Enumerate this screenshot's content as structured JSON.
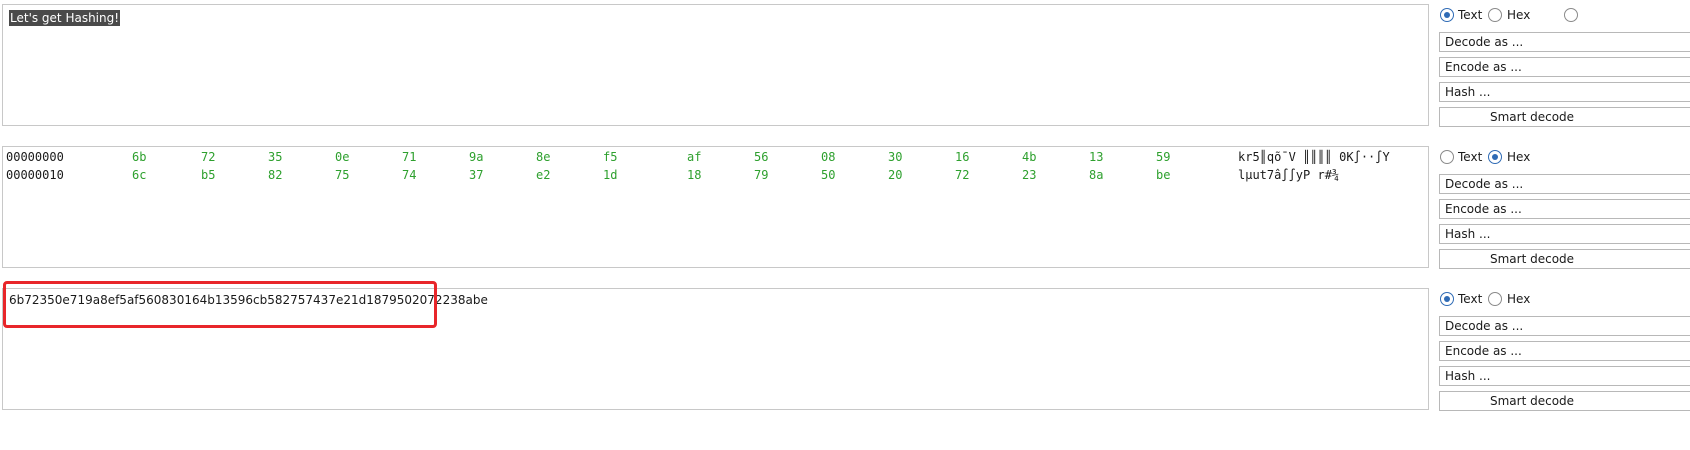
{
  "panels": [
    {
      "content_text": "Let's get Hashing!",
      "mode_options": [
        "Text",
        "Hex"
      ],
      "selected_mode": "Text",
      "decode_label": "Decode as ...",
      "encode_label": "Encode as ...",
      "hash_label": "Hash ...",
      "smart_decode_label": "Smart decode"
    },
    {
      "hex_rows": [
        {
          "offset": "00000000",
          "bytes": [
            "6b",
            "72",
            "35",
            "0e",
            "71",
            "9a",
            "8e",
            "f5",
            "af",
            "56",
            "08",
            "30",
            "16",
            "4b",
            "13",
            "59"
          ],
          "ascii": "kr5║qõˉV ║║║║ 0K∫··∫Y"
        },
        {
          "offset": "00000010",
          "bytes": [
            "6c",
            "b5",
            "82",
            "75",
            "74",
            "37",
            "e2",
            "1d",
            "18",
            "79",
            "50",
            "20",
            "72",
            "23",
            "8a",
            "be"
          ],
          "ascii": "lµut7â∫∫yP r#¾"
        }
      ],
      "mode_options": [
        "Text",
        "Hex"
      ],
      "selected_mode": "Hex",
      "decode_label": "Decode as ...",
      "encode_label": "Encode as ...",
      "hash_label": "Hash ...",
      "smart_decode_label": "Smart decode"
    },
    {
      "content_text": "6b72350e719a8ef5af560830164b13596cb582757437e21d1879502072238abe",
      "mode_options": [
        "Text",
        "Hex"
      ],
      "selected_mode": "Text",
      "decode_label": "Decode as ...",
      "encode_label": "Encode as ...",
      "hash_label": "Hash ...",
      "smart_decode_label": "Smart decode"
    }
  ],
  "colors": {
    "hex_bytes": "#2ea02e",
    "highlight_box": "#e8262a",
    "radio_selected": "#2f6bb5",
    "selection_bg": "#4a4a4a"
  }
}
